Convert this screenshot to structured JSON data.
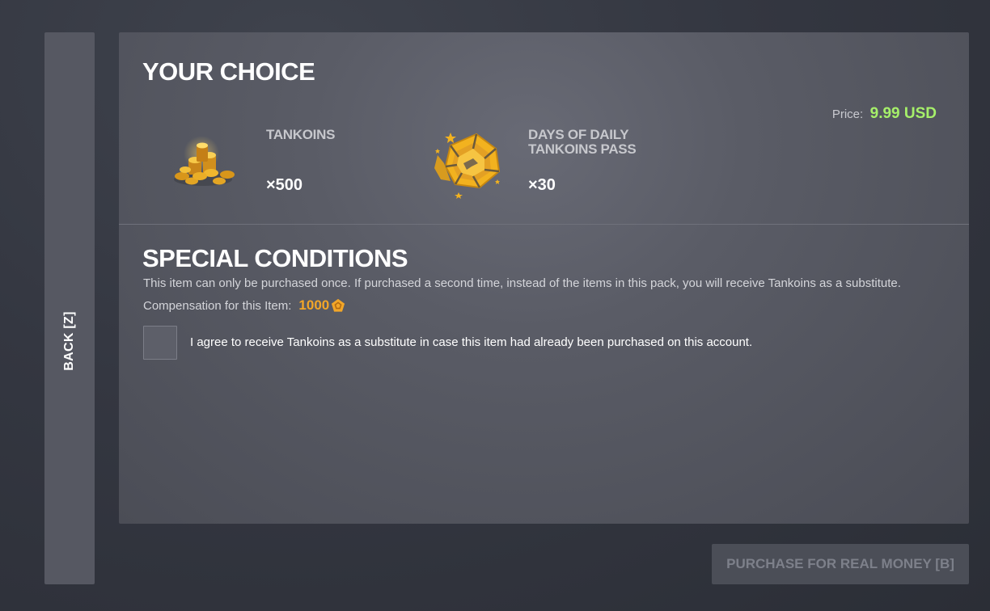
{
  "back_button": {
    "label": "BACK [Z]"
  },
  "choice": {
    "title": "YOUR CHOICE",
    "price_label": "Price:",
    "price_value": "9.99 USD",
    "items": [
      {
        "name": "TANKOINS",
        "quantity": "×500",
        "icon": "tankoins-pile-icon"
      },
      {
        "name": "DAYS OF DAILY TANKOINS PASS",
        "quantity": "×30",
        "icon": "daily-pass-icon"
      }
    ]
  },
  "conditions": {
    "title": "SPECIAL CONDITIONS",
    "description": "This item can only be purchased once. If purchased a second time, instead of the items in this pack, you will receive Tankoins as a substitute.",
    "compensation_label": "Compensation for this Item:",
    "compensation_value": "1000",
    "compensation_icon": "tankoin-icon",
    "checkbox_checked": false,
    "agree_text": "I agree to receive Tankoins as a substitute in case this item had already been purchased on this account."
  },
  "purchase_button": {
    "label": "PURCHASE FOR REAL MONEY [B]",
    "enabled": false
  },
  "colors": {
    "price": "#a6f06a",
    "compensation": "#f2a628",
    "gold": "#f2b21f"
  }
}
